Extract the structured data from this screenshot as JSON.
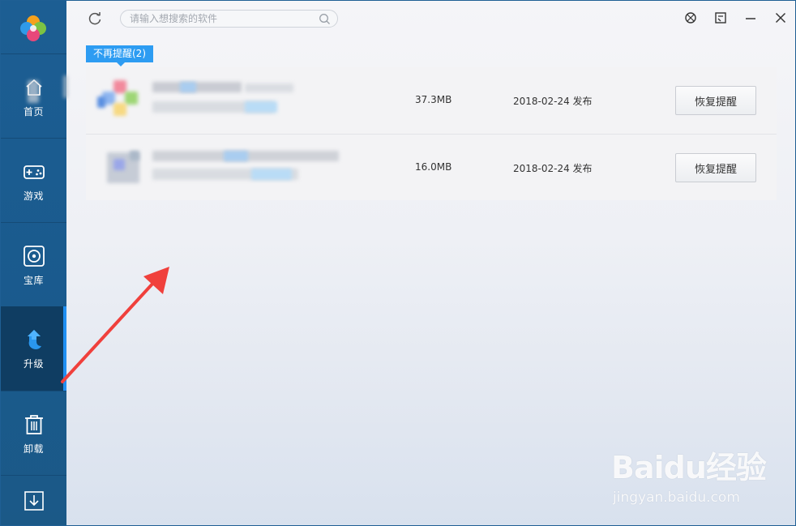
{
  "sidebar": {
    "items": [
      {
        "label": "首页",
        "icon": "home-icon",
        "active": false
      },
      {
        "label": "游戏",
        "icon": "gamepad-icon",
        "active": false
      },
      {
        "label": "宝库",
        "icon": "treasury-icon",
        "active": false
      },
      {
        "label": "升级",
        "icon": "upgrade-icon",
        "active": true
      },
      {
        "label": "卸载",
        "icon": "trash-icon",
        "active": false
      }
    ],
    "download_icon": "download-icon"
  },
  "topbar": {
    "search_placeholder": "请输入想搜索的软件",
    "icons": [
      "refresh-icon",
      "search-icon",
      "skin-icon",
      "feedback-icon",
      "minimize-icon",
      "close-icon"
    ]
  },
  "section": {
    "tab_label": "不再提醒(2)"
  },
  "apps": [
    {
      "size": "37.3MB",
      "date": "2018-02-24 发布",
      "action": "恢复提醒"
    },
    {
      "size": "16.0MB",
      "date": "2018-02-24 发布",
      "action": "恢复提醒"
    }
  ],
  "watermark": {
    "brand": "Baidu经验",
    "url": "jingyan.baidu.com"
  },
  "colors": {
    "sidebar": "#1c5e93",
    "sidebar_active": "#0f3d62",
    "accent": "#2d9cf2",
    "annotation_arrow": "#f0403c"
  }
}
